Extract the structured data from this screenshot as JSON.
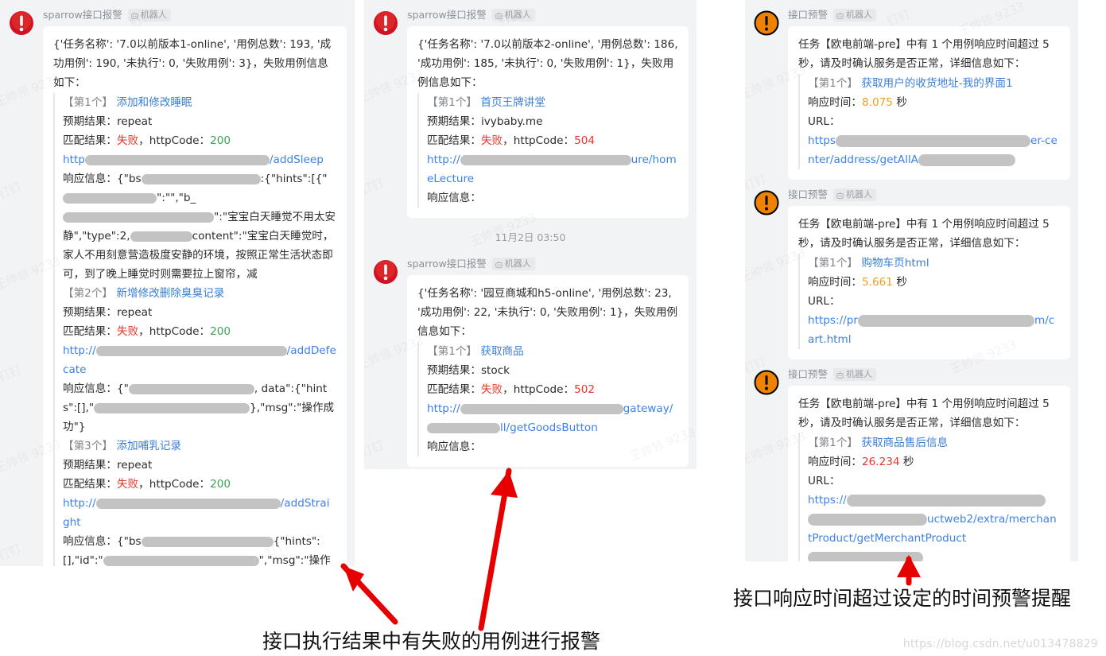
{
  "watermarks": {
    "user": "王帅领 9233",
    "app": "钉钉"
  },
  "bot_badge_label": "机器人",
  "colors": {
    "fail_red": "#e8362a",
    "ok_green": "#3aa355",
    "link_blue": "#3b82e8",
    "warn_orange": "#f0a020",
    "panel_bg": "#f2f3f5",
    "bubble_bg": "#ffffff",
    "alert_avatar_red": "#cf1322",
    "alert_avatar_orange": "#f08200"
  },
  "panels": [
    {
      "id": "panel-left",
      "messages": [
        {
          "sender": "sparrow接口报警",
          "avatar_icon": "error-circle-icon",
          "avatar_color": "#cf1322",
          "summary": "{'任务名称': '7.0以前版本1-online', '用例总数': 193, '成功用例': 190, '未执行': 0, '失败用例': 3}，失败用例信息如下：",
          "cases": [
            {
              "index_label": "【第1个】",
              "name": "添加和修改睡眠",
              "expect_label": "预期结果：",
              "expect_value": "repeat",
              "match_label": "匹配结果：",
              "match_value": "失败",
              "http_label": "httpCode：",
              "http_value": "200",
              "http_status": "ok",
              "url_prefix": "http",
              "url_suffix": "/addSleep",
              "resp_label": "响应信息：",
              "resp_parts": [
                "{\"bs",
                ":{\"hints\":",
                "[{\"",
                "\":\"",
                "\",\"b_",
                "\":\"宝宝白天睡觉不用太安静\",\"type\":2,",
                "content\":\"宝宝白天睡觉时，家人不用刻意营造极度安静的环境，按照正常生活状态即可，到了晚上睡觉时则需要拉上窗帘，减"
              ]
            },
            {
              "index_label": "【第2个】",
              "name": "新增修改删除臭臭记录",
              "expect_label": "预期结果：",
              "expect_value": "repeat",
              "match_label": "匹配结果：",
              "match_value": "失败",
              "http_label": "httpCode：",
              "http_value": "200",
              "http_status": "ok",
              "url_prefix": "http://",
              "url_suffix": "/addDefecate",
              "resp_label": "响应信息：",
              "resp_parts": [
                "{\"",
                "\"",
                ", data\":{\"hints\":[],\"",
                "},\"msg\":\"操作成功\"}"
              ]
            },
            {
              "index_label": "【第3个】",
              "name": "添加哺乳记录",
              "expect_label": "预期结果：",
              "expect_value": "repeat",
              "match_label": "匹配结果：",
              "match_value": "失败",
              "http_label": "httpCode：",
              "http_value": "200",
              "http_status": "ok",
              "url_prefix": "http://",
              "url_suffix": "/addStraight",
              "resp_label": "响应信息：",
              "resp_parts": [
                "{\"bs",
                "{\"hints\":[],\"id\":\"",
                "\",\"msg\":\"操作成功\"}"
              ]
            }
          ]
        }
      ]
    },
    {
      "id": "panel-mid",
      "messages": [
        {
          "sender": "sparrow接口报警",
          "avatar_icon": "error-circle-icon",
          "avatar_color": "#cf1322",
          "summary": "{'任务名称': '7.0以前版本2-online', '用例总数': 186, '成功用例': 185, '未执行': 0, '失败用例': 1}，失败用例信息如下：",
          "cases": [
            {
              "index_label": "【第1个】",
              "name": "首页王牌讲堂",
              "expect_label": "预期结果：",
              "expect_value": "ivybaby.me",
              "match_label": "匹配结果：",
              "match_value": "失败",
              "http_label": "httpCode：",
              "http_value": "504",
              "http_status": "err",
              "url_prefix": "http://",
              "url_suffix": "ure/homeLecture",
              "resp_label": "响应信息：",
              "resp_parts": []
            }
          ]
        }
      ],
      "divider": "11月2日 03:50",
      "messages_after_divider": [
        {
          "sender": "sparrow接口报警",
          "avatar_icon": "error-circle-icon",
          "avatar_color": "#cf1322",
          "summary": "{'任务名称': '园豆商城和h5-online', '用例总数': 23, '成功用例': 22, '未执行': 0, '失败用例': 1}，失败用例信息如下：",
          "cases": [
            {
              "index_label": "【第1个】",
              "name": "获取商品",
              "expect_label": "预期结果：",
              "expect_value": "stock",
              "match_label": "匹配结果：",
              "match_value": "失败",
              "http_label": "httpCode：",
              "http_value": "502",
              "http_status": "err",
              "url_prefix": "http://",
              "url_suffix": "ll/getGoodsButton",
              "url_mid": "gateway/",
              "resp_label": "响应信息：",
              "resp_parts": []
            }
          ]
        }
      ]
    },
    {
      "id": "panel-right",
      "messages": [
        {
          "sender": "接口预警",
          "avatar_icon": "warning-circle-icon",
          "avatar_color": "#f08200",
          "summary": "任务【欧电前端-pre】中有 1 个用例响应时间超过 5 秒，请及时确认服务是否正常，详细信息如下：",
          "cases": [
            {
              "index_label": "【第1个】",
              "name": "获取用户的收货地址-我的界面1",
              "rt_label": "响应时间：",
              "rt_value": "8.075",
              "rt_unit": "秒",
              "rt_level": "warn",
              "url_label": "URL：",
              "url_prefix": "https",
              "url_mid": "er-center/address/getAllA",
              "url_suffix": ""
            }
          ]
        },
        {
          "sender": "接口预警",
          "avatar_icon": "warning-circle-icon",
          "avatar_color": "#f08200",
          "summary": "任务【欧电前端-pre】中有 1 个用例响应时间超过 5 秒，请及时确认服务是否正常，详细信息如下：",
          "cases": [
            {
              "index_label": "【第1个】",
              "name": "购物车页html",
              "rt_label": "响应时间：",
              "rt_value": "5.661",
              "rt_unit": "秒",
              "rt_level": "warn",
              "url_label": "URL：",
              "url_prefix": "https://pr",
              "url_mid": "",
              "url_suffix": "m/cart.html"
            }
          ]
        },
        {
          "sender": "接口预警",
          "avatar_icon": "warning-circle-icon",
          "avatar_color": "#f08200",
          "summary": "任务【欧电前端-pre】中有 1 个用例响应时间超过 5 秒，请及时确认服务是否正常，详细信息如下：",
          "cases": [
            {
              "index_label": "【第1个】",
              "name": "获取商品售后信息",
              "rt_label": "响应时间：",
              "rt_value": "26.234",
              "rt_unit": "秒",
              "rt_level": "bad",
              "url_label": "URL：",
              "url_prefix": "https://",
              "url_mid": "uct",
              "url_suffix": "web2/extra/merchantProduct/getMerchantProduct"
            }
          ]
        }
      ]
    }
  ],
  "annotations": {
    "left_note": "接口执行结果中有失败的用例进行报警",
    "right_note": "接口响应时间超过设定的时间预警提醒",
    "arrow_color": "#e60000"
  },
  "source_watermark": "https://blog.csdn.net/u013478829"
}
